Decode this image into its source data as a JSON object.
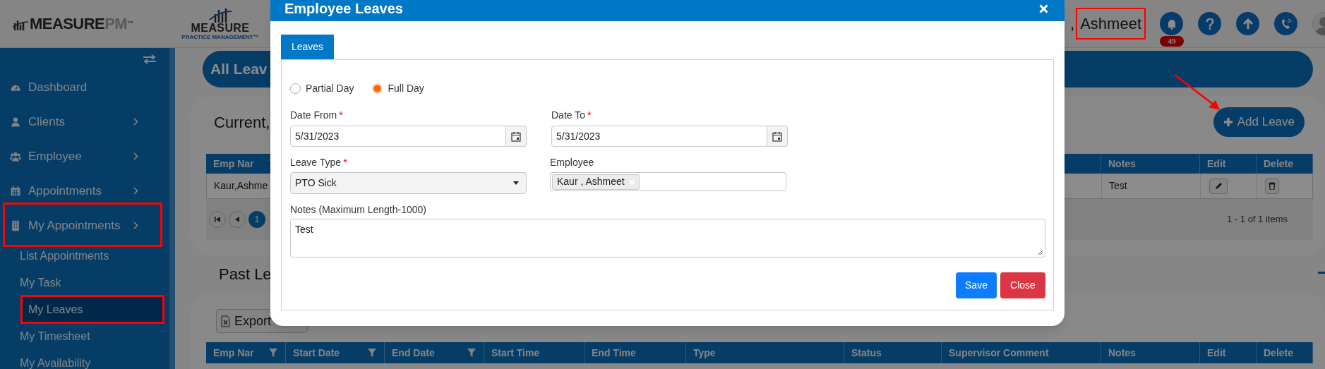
{
  "header": {
    "logo_main": "MEASURE",
    "logo_suffix": "PM",
    "logo_tm": "™",
    "brand_name": "MEASURE",
    "brand_tagline": "PRACTICE MANAGEMENT™",
    "user_prefix": ",",
    "user_name": "Ashmeet",
    "user_annotated": true,
    "notification_count": "49"
  },
  "sidebar": {
    "items": [
      {
        "label": "Dashboard",
        "chevron": false,
        "annotated": false
      },
      {
        "label": "Clients",
        "chevron": true,
        "annotated": false
      },
      {
        "label": "Employee",
        "chevron": true,
        "annotated": false
      },
      {
        "label": "Appointments",
        "chevron": true,
        "annotated": false
      },
      {
        "label": "My Appointments",
        "chevron": true,
        "annotated": true,
        "children": [
          {
            "label": "List Appointments",
            "selected": false,
            "annotated": false
          },
          {
            "label": "My Task",
            "selected": false,
            "annotated": false
          },
          {
            "label": "My Leaves",
            "selected": true,
            "annotated": true
          },
          {
            "label": "My Timesheet",
            "selected": false,
            "annotated": false
          },
          {
            "label": "My Availability",
            "selected": false,
            "annotated": false
          }
        ]
      }
    ]
  },
  "page": {
    "title": "All Leav",
    "current": {
      "title": "Current,",
      "add_button": "Add Leave",
      "columns": [
        {
          "label": "Emp Nar",
          "filter": true
        },
        {
          "label": "Notes",
          "filter": false
        },
        {
          "label": "Edit",
          "filter": false
        },
        {
          "label": "Delete",
          "filter": false
        }
      ],
      "rows": [
        {
          "employee": "Kaur,Ashme",
          "notes": "Test"
        }
      ],
      "pages": [
        {
          "label": "1",
          "selected": true
        }
      ],
      "summary": "1 - 1 of 1 items"
    },
    "past": {
      "title": "Past Le",
      "export_button": "Export",
      "columns": [
        {
          "label": "Emp Nar",
          "filter": true
        },
        {
          "label": "Start Date",
          "filter": true
        },
        {
          "label": "End Date",
          "filter": true
        },
        {
          "label": "Start Time",
          "filter": false
        },
        {
          "label": "End Time",
          "filter": false
        },
        {
          "label": "Type",
          "filter": false
        },
        {
          "label": "Status",
          "filter": false
        },
        {
          "label": "Supervisor Comment",
          "filter": false
        },
        {
          "label": "Notes",
          "filter": false
        },
        {
          "label": "Edit",
          "filter": false
        },
        {
          "label": "Delete",
          "filter": false
        }
      ]
    }
  },
  "modal": {
    "title": "Employee Leaves",
    "tabs": [
      {
        "label": "Leaves",
        "selected": true
      }
    ],
    "day_options": [
      {
        "label": "Partial Day",
        "selected": false
      },
      {
        "label": "Full Day",
        "selected": true
      }
    ],
    "date_from": {
      "label": "Date From",
      "required_mark": "*",
      "value": "5/31/2023"
    },
    "date_to": {
      "label": "Date To",
      "required_mark": "*",
      "value": "5/31/2023"
    },
    "leave_type": {
      "label": "Leave Type",
      "required_mark": "*",
      "value": "PTO Sick"
    },
    "employee": {
      "label": "Employee",
      "tags": [
        "Kaur , Ashmeet"
      ]
    },
    "notes": {
      "label": "Notes (Maximum Length-1000)",
      "value": "Test"
    },
    "buttons": [
      {
        "label": "Save",
        "kind": "primary"
      },
      {
        "label": "Close",
        "kind": "danger"
      }
    ]
  }
}
